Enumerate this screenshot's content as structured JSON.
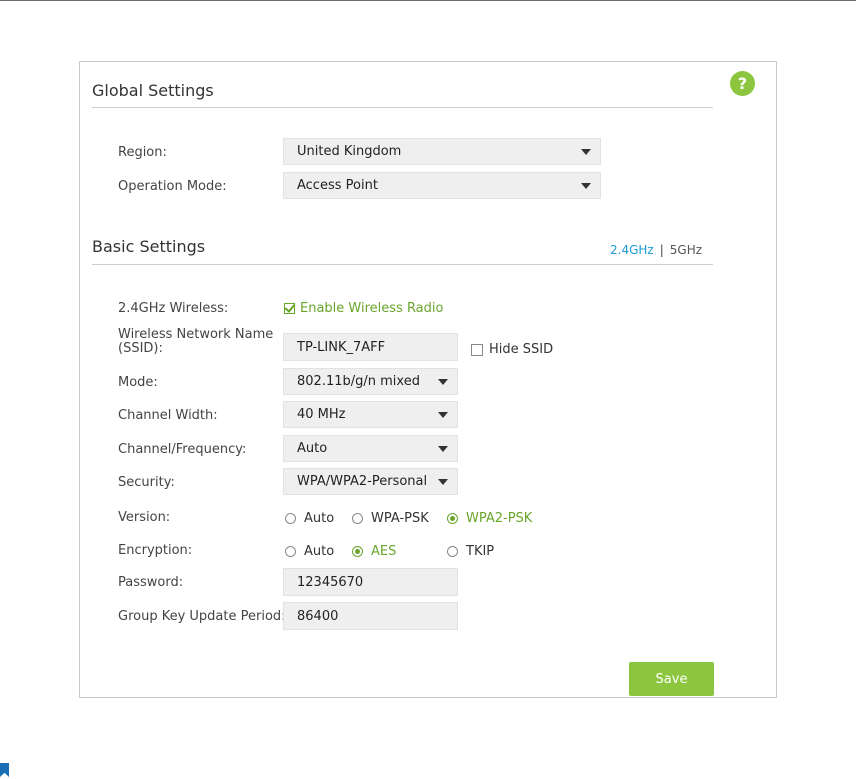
{
  "help": {
    "icon_glyph": "?"
  },
  "global": {
    "title": "Global Settings",
    "region_label": "Region:",
    "region_value": "United Kingdom",
    "operation_label": "Operation Mode:",
    "operation_value": "Access Point"
  },
  "basic": {
    "title": "Basic Settings",
    "band_tabs": [
      "2.4GHz",
      "5GHz"
    ],
    "band_separator": "|",
    "active_band": "2.4GHz",
    "wireless_label": "2.4GHz Wireless:",
    "enable_radio_label": "Enable Wireless Radio",
    "enable_radio_checked": true,
    "ssid_label_line1": "Wireless Network Name",
    "ssid_label_line2": "(SSID):",
    "ssid_value": "TP-LINK_7AFF",
    "hide_ssid_label": "Hide SSID",
    "hide_ssid_checked": false,
    "mode_label": "Mode:",
    "mode_value": "802.11b/g/n mixed",
    "channel_width_label": "Channel Width:",
    "channel_width_value": "40 MHz",
    "channel_label": "Channel/Frequency:",
    "channel_value": "Auto",
    "security_label": "Security:",
    "security_value": "WPA/WPA2-Personal",
    "version_label": "Version:",
    "version_options": [
      "Auto",
      "WPA-PSK",
      "WPA2-PSK"
    ],
    "version_selected": "WPA2-PSK",
    "encryption_label": "Encryption:",
    "encryption_options": [
      "Auto",
      "AES",
      "TKIP"
    ],
    "encryption_selected": "AES",
    "password_label": "Password:",
    "password_value": "12345670",
    "group_key_label": "Group Key Update Period:",
    "group_key_value": "86400"
  },
  "save_label": "Save",
  "colors": {
    "accent_green": "#8cc63f",
    "selected_green": "#6aa52c",
    "link_blue": "#1e9bd7"
  }
}
